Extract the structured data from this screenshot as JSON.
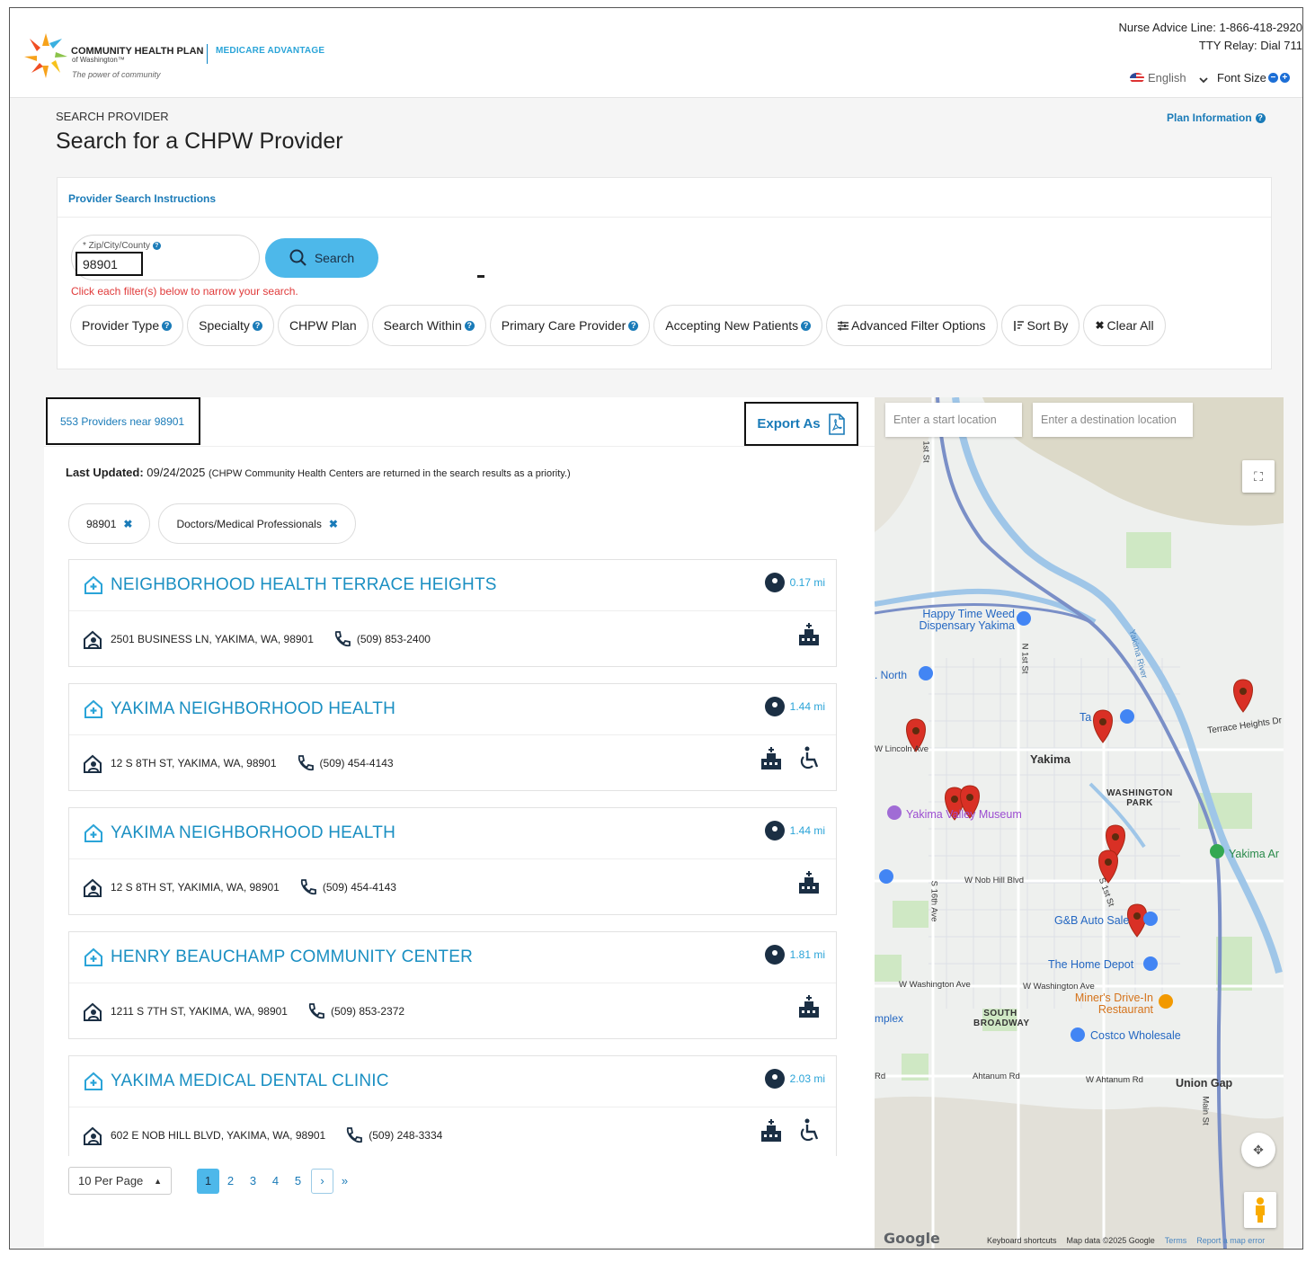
{
  "header": {
    "brand_name": "COMMUNITY HEALTH PLAN",
    "brand_sub": "of Washington™",
    "brand_tagline": "The power of community",
    "brand_product": "MEDICARE ADVANTAGE",
    "nurse_line": "Nurse Advice Line: 1-866-418-2920",
    "tty_line": "TTY Relay: Dial 711",
    "language": "English",
    "font_size_label": "Font Size"
  },
  "page": {
    "eyebrow": "SEARCH PROVIDER",
    "title": "Search for a CHPW Provider",
    "plan_info": "Plan Information"
  },
  "search": {
    "instructions_link": "Provider Search Instructions",
    "zip_label": "* Zip/City/County",
    "zip_value": "98901",
    "search_button": "Search",
    "hint": "Click each filter(s) below to narrow your search."
  },
  "filters": [
    {
      "label": "Provider Type",
      "help": true
    },
    {
      "label": "Specialty",
      "help": true
    },
    {
      "label": "CHPW Plan",
      "help": false
    },
    {
      "label": "Search Within",
      "help": true
    },
    {
      "label": "Primary Care Provider",
      "help": true
    },
    {
      "label": "Accepting New Patients",
      "help": true
    },
    {
      "label": "Advanced Filter Options",
      "help": false
    },
    {
      "label": "Sort By",
      "help": false
    },
    {
      "label": "Clear All",
      "help": false
    }
  ],
  "results": {
    "count_text": "553 Providers near 98901",
    "export_label": "Export As",
    "last_updated_label": "Last Updated:",
    "last_updated_value": "09/24/2025",
    "last_updated_note": "(CHPW Community Health Centers are returned in the search results as a priority.)",
    "tags": [
      "98901",
      "Doctors/Medical Professionals"
    ]
  },
  "providers": [
    {
      "name": "NEIGHBORHOOD HEALTH TERRACE HEIGHTS",
      "distance": "0.17 mi",
      "address": "2501 BUSINESS LN, YAKIMA, WA, 98901",
      "phone": "(509) 853-2400",
      "accessible": false
    },
    {
      "name": "YAKIMA NEIGHBORHOOD HEALTH",
      "distance": "1.44 mi",
      "address": "12 S 8TH ST, YAKIMA, WA, 98901",
      "phone": "(509) 454-4143",
      "accessible": true
    },
    {
      "name": "YAKIMA NEIGHBORHOOD HEALTH",
      "distance": "1.44 mi",
      "address": "12 S 8TH ST, YAKIMIA, WA, 98901",
      "phone": "(509) 454-4143",
      "accessible": false
    },
    {
      "name": "HENRY BEAUCHAMP COMMUNITY CENTER",
      "distance": "1.81 mi",
      "address": "1211 S 7TH ST, YAKIMA, WA, 98901",
      "phone": "(509) 853-2372",
      "accessible": false
    },
    {
      "name": "YAKIMA MEDICAL DENTAL CLINIC",
      "distance": "2.03 mi",
      "address": "602 E NOB HILL BLVD, YAKIMA, WA, 98901",
      "phone": "(509) 248-3334",
      "accessible": true
    }
  ],
  "pagination": {
    "per_page": "10 Per Page",
    "pages": [
      "1",
      "2",
      "3",
      "4",
      "5"
    ],
    "next": "›",
    "last": "»"
  },
  "map": {
    "start_placeholder": "Enter a start location",
    "dest_placeholder": "Enter a destination location",
    "labels": {
      "yakima": "Yakima",
      "washington_park": "WASHINGTON PARK",
      "south_broadway": "SOUTH BROADWAY",
      "union_gap": "Union Gap",
      "terrace_heights": "Terrace Heights Dr",
      "w_lincoln": "W Lincoln Ave",
      "w_nob_hill": "W Nob Hill Blvd",
      "w_washington_1": "W Washington Ave",
      "w_washington_2": "W Washington Ave",
      "ahtanum": "Ahtanum Rd",
      "w_ahtanum": "W Ahtanum Rd",
      "n1st": "N 1st St",
      "s1st": "S 1st St",
      "s16th": "S 16th Ave",
      "main_st": "Main St",
      "north": ". North",
      "mplex": "mplex",
      "rd": "Rd",
      "yakima_river": "Yakima River",
      "first_st": "1st St"
    },
    "pois": {
      "happy_time": "Happy Time Weed Dispensary Yakima",
      "museum": "Yakima Valley Museum",
      "gb_auto": "G&B Auto Sale",
      "home_depot": "The Home Depot",
      "miners": "Miner's Drive-In Restaurant",
      "costco": "Costco Wholesale",
      "yakima_ar": "Yakima Ar",
      "ta": "Ta"
    },
    "footer": {
      "google": "Google",
      "shortcuts": "Keyboard shortcuts",
      "mapdata": "Map data ©2025 Google",
      "terms": "Terms",
      "report": "Report a map error"
    },
    "colors": {
      "marker": "#d93025",
      "highway": "#7a8fc7",
      "river": "#9fc6e8",
      "park": "#cfe8c4"
    }
  }
}
